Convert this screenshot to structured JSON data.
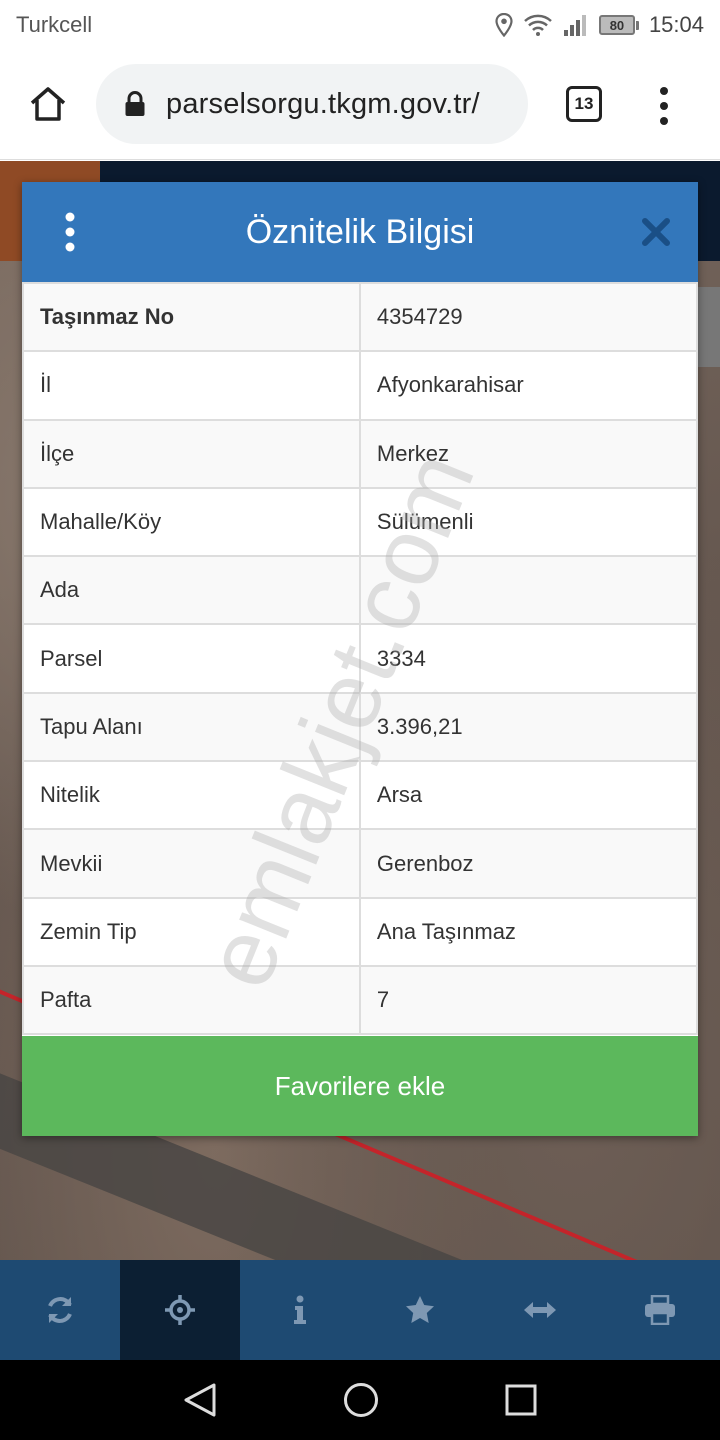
{
  "status_bar": {
    "carrier": "Turkcell",
    "battery": "80",
    "time": "15:04"
  },
  "browser": {
    "url": "parselsorgu.tkgm.gov.tr/",
    "tab_count": "13"
  },
  "modal": {
    "title": "Öznitelik Bilgisi",
    "rows": [
      {
        "key": "Taşınmaz No",
        "value": "4354729"
      },
      {
        "key": "İl",
        "value": "Afyonkarahisar"
      },
      {
        "key": "İlçe",
        "value": "Merkez"
      },
      {
        "key": "Mahalle/Köy",
        "value": "Sülümenli"
      },
      {
        "key": "Ada",
        "value": ""
      },
      {
        "key": "Parsel",
        "value": "3334"
      },
      {
        "key": "Tapu Alanı",
        "value": "3.396,21"
      },
      {
        "key": "Nitelik",
        "value": "Arsa"
      },
      {
        "key": "Mevkii",
        "value": "Gerenboz"
      },
      {
        "key": "Zemin Tip",
        "value": "Ana Taşınmaz"
      },
      {
        "key": "Pafta",
        "value": "7"
      }
    ],
    "favorite_button": "Favorilere ekle"
  },
  "watermark": "emlakjet.com",
  "toolbar": {
    "items": [
      "refresh-icon",
      "crosshair-icon",
      "info-icon",
      "star-icon",
      "resize-horizontal-icon",
      "print-icon"
    ],
    "active_index": 1
  },
  "colors": {
    "header_blue": "#3377bb",
    "favorite_green": "#5cb85c",
    "toolbar_bg": "#1e4a72",
    "toolbar_active": "#0c1f33"
  }
}
